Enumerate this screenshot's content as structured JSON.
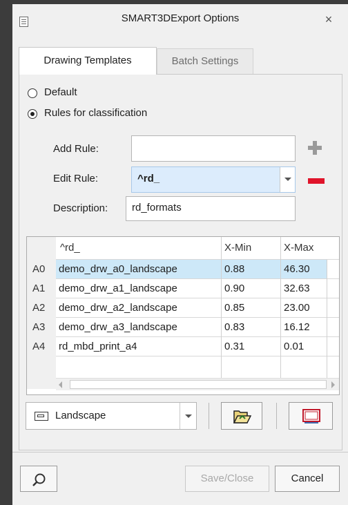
{
  "window": {
    "title": "SMART3DExport Options",
    "close_symbol": "×"
  },
  "tabs": [
    {
      "label": "Drawing Templates",
      "active": true
    },
    {
      "label": "Batch Settings",
      "active": false
    }
  ],
  "options": {
    "radio_default_label": "Default",
    "radio_rules_label": "Rules for classification",
    "selected": "Rules for classification"
  },
  "form": {
    "add_rule_label": "Add Rule:",
    "add_rule_value": "",
    "edit_rule_label": "Edit Rule:",
    "edit_rule_value": "^rd_",
    "description_label": "Description:",
    "description_value": "rd_formats"
  },
  "grid": {
    "columns": [
      "^rd_",
      "X-Min",
      "X-Max"
    ],
    "rows": [
      {
        "id": "A0",
        "name": "demo_drw_a0_landscape",
        "xmin": "0.88",
        "xmax": "46.30",
        "selected": true
      },
      {
        "id": "A1",
        "name": "demo_drw_a1_landscape",
        "xmin": "0.90",
        "xmax": "32.63",
        "selected": false
      },
      {
        "id": "A2",
        "name": "demo_drw_a2_landscape",
        "xmin": "0.85",
        "xmax": "23.00",
        "selected": false
      },
      {
        "id": "A3",
        "name": "demo_drw_a3_landscape",
        "xmin": "0.83",
        "xmax": "16.12",
        "selected": false
      },
      {
        "id": "A4",
        "name": "rd_mbd_print_a4",
        "xmin": "0.31",
        "xmax": "0.01",
        "selected": false
      }
    ]
  },
  "bottom_toolbar": {
    "orientation_value": "Landscape"
  },
  "footer": {
    "save_close_label": "Save/Close",
    "cancel_label": "Cancel"
  },
  "colors": {
    "selection": "#cde8f8",
    "remove_rule": "#e0142a",
    "background": "#f0f0f0"
  }
}
